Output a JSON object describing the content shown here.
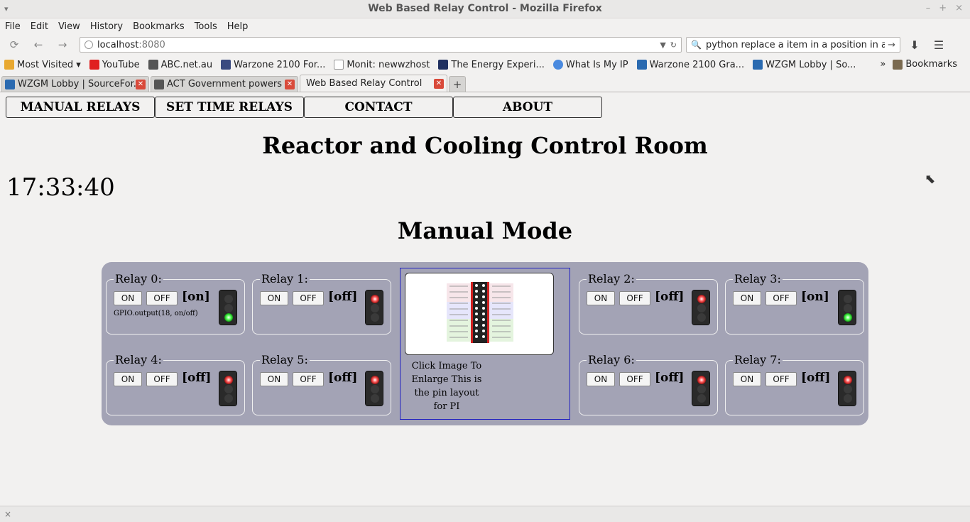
{
  "window": {
    "title": "Web Based Relay Control - Mozilla Firefox"
  },
  "menu": [
    "File",
    "Edit",
    "View",
    "History",
    "Bookmarks",
    "Tools",
    "Help"
  ],
  "url": {
    "host": "localhost",
    "port": ":8080"
  },
  "search": {
    "value": "python replace a item in a position in a file"
  },
  "bookmarks": {
    "items": [
      "Most Visited ▾",
      "YouTube",
      "ABC.net.au",
      "Warzone 2100 For...",
      "Monit: newwzhost",
      "The Energy Experi...",
      "What Is My IP",
      "Warzone 2100 Gra...",
      "WZGM Lobby | So..."
    ],
    "overflow": "»",
    "folder": "Bookmarks"
  },
  "tabs": [
    "WZGM Lobby | SourceFor...",
    "ACT Government powers ...",
    "Web Based Relay Control"
  ],
  "page": {
    "nav": [
      "MANUAL RELAYS",
      "SET TIME RELAYS",
      "CONTACT",
      "ABOUT"
    ],
    "title": "Reactor and Cooling Control Room",
    "clock": "17:33:40",
    "mode_title": "Manual Mode",
    "on_label": "ON",
    "off_label": "OFF",
    "relays": [
      {
        "label": "Relay 0:",
        "state": "[on]",
        "light": "green",
        "note": "GPIO.output(18, on/off)"
      },
      {
        "label": "Relay 1:",
        "state": "[off]",
        "light": "red"
      },
      {
        "label": "Relay 2:",
        "state": "[off]",
        "light": "red"
      },
      {
        "label": "Relay 3:",
        "state": "[on]",
        "light": "green"
      },
      {
        "label": "Relay 4:",
        "state": "[off]",
        "light": "red"
      },
      {
        "label": "Relay 5:",
        "state": "[off]",
        "light": "red"
      },
      {
        "label": "Relay 6:",
        "state": "[off]",
        "light": "red"
      },
      {
        "label": "Relay 7:",
        "state": "[off]",
        "light": "red"
      }
    ],
    "pin_caption": "Click Image To Enlarge This is the pin layout for PI"
  },
  "colors": {
    "panel": "#a3a3b5",
    "pin_border": "#2020c0",
    "tab_close": "#d94a3a"
  }
}
